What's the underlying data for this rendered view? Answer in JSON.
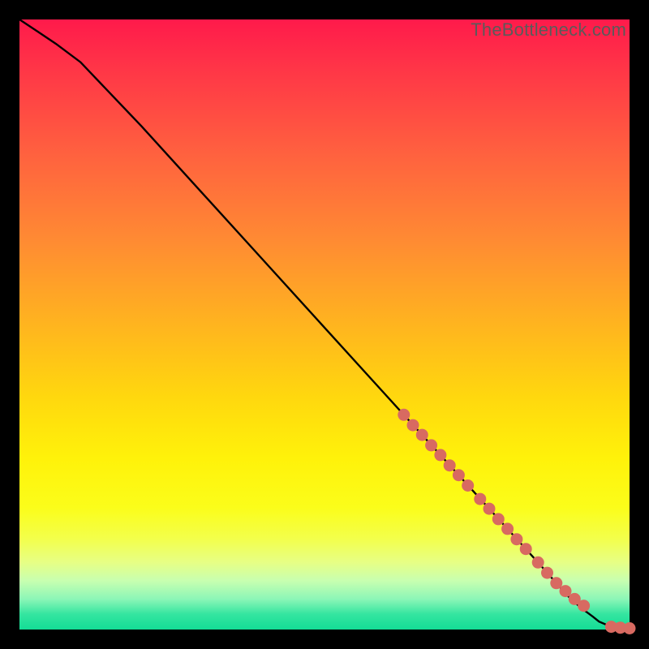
{
  "watermark": "TheBottleneck.com",
  "chart_data": {
    "type": "line",
    "xlim": [
      0,
      100
    ],
    "ylim": [
      0,
      100
    ],
    "title": "",
    "xlabel": "",
    "ylabel": "",
    "series": [
      {
        "name": "curve",
        "x": [
          0,
          3,
          6,
          10,
          20,
          30,
          40,
          50,
          60,
          70,
          75,
          80,
          85,
          88,
          90,
          92,
          94,
          95,
          97,
          98,
          100
        ],
        "y": [
          100,
          98,
          96,
          93,
          82.5,
          71.5,
          60.5,
          49.5,
          38.5,
          27.5,
          22,
          16.5,
          11,
          7.6,
          5.4,
          3.6,
          2.1,
          1.3,
          0.45,
          0.25,
          0.2
        ]
      }
    ],
    "markers": {
      "name": "highlight-points",
      "color": "#d86a61",
      "x": [
        63,
        64.5,
        66,
        67.5,
        69,
        70.5,
        72,
        73.5,
        75.5,
        77,
        78.5,
        80,
        81.5,
        83,
        85,
        86.5,
        88,
        89.5,
        91,
        92.5,
        97,
        98.5,
        100
      ],
      "y": [
        35.2,
        33.5,
        31.9,
        30.2,
        28.6,
        26.9,
        25.3,
        23.6,
        21.4,
        19.8,
        18.1,
        16.5,
        14.8,
        13.2,
        11.0,
        9.3,
        7.6,
        6.3,
        5.0,
        3.9,
        0.45,
        0.3,
        0.2
      ]
    }
  }
}
